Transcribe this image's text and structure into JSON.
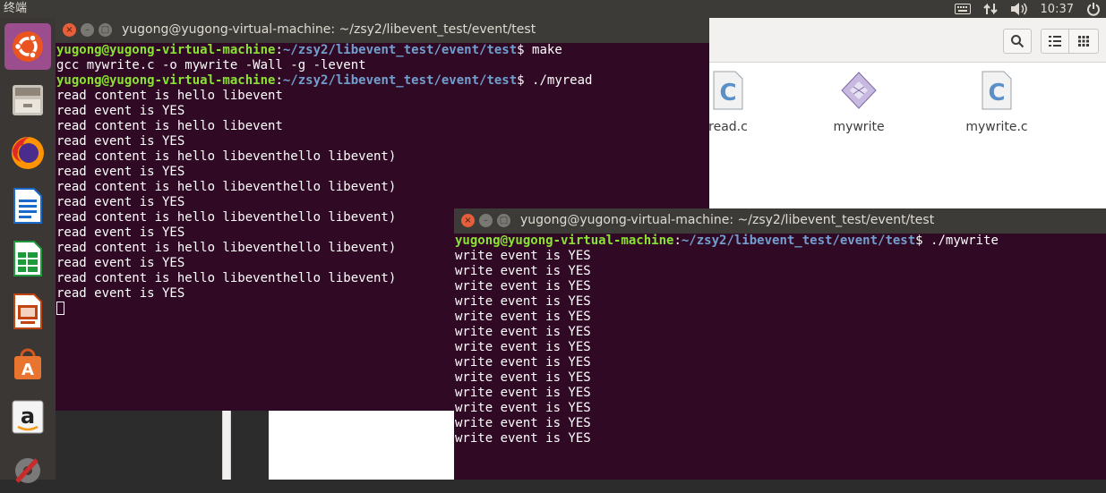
{
  "topbar": {
    "app_title": "终端",
    "time": "10:37"
  },
  "tray_icons": [
    "keyboard-icon",
    "network-icon",
    "volume-icon",
    "power-icon"
  ],
  "launcher": {
    "items": [
      "ubuntu-dash-icon",
      "files-icon",
      "firefox-icon",
      "writer-icon",
      "calc-icon",
      "impress-icon",
      "software-center-icon",
      "amazon-icon",
      "system-settings-icon"
    ]
  },
  "file_manager": {
    "files": [
      {
        "name": "read.c",
        "icon": "c-source-file-icon"
      },
      {
        "name": "mywrite",
        "icon": "executable-file-icon"
      },
      {
        "name": "mywrite.c",
        "icon": "c-source-file-icon"
      }
    ]
  },
  "terminal_read": {
    "title": "yugong@yugong-virtual-machine: ~/zsy2/libevent_test/event/test",
    "lines": [
      {
        "user": "yugong@yugong-virtual-machine",
        "path": "~/zsy2/libevent_test/event/test",
        "cmd": "$ make"
      },
      {
        "text": "gcc mywrite.c -o mywrite -Wall -g -levent"
      },
      {
        "user": "yugong@yugong-virtual-machine",
        "path": "~/zsy2/libevent_test/event/test",
        "cmd": "$ ./myread"
      },
      {
        "text": "read content is hello libevent"
      },
      {
        "text": "read event is YES"
      },
      {
        "text": "read content is hello libevent"
      },
      {
        "text": "read event is YES"
      },
      {
        "text": "read content is hello libeventhello libevent)"
      },
      {
        "text": "read event is YES"
      },
      {
        "text": "read content is hello libeventhello libevent)"
      },
      {
        "text": "read event is YES"
      },
      {
        "text": "read content is hello libeventhello libevent)"
      },
      {
        "text": "read event is YES"
      },
      {
        "text": "read content is hello libeventhello libevent)"
      },
      {
        "text": "read event is YES"
      },
      {
        "text": "read content is hello libeventhello libevent)"
      },
      {
        "text": "read event is YES"
      }
    ]
  },
  "terminal_write": {
    "title": "yugong@yugong-virtual-machine: ~/zsy2/libevent_test/event/test",
    "lines": [
      {
        "user": "yugong@yugong-virtual-machine",
        "path": "~/zsy2/libevent_test/event/test",
        "cmd": "$ ./mywrite"
      },
      {
        "text": "write event is YES"
      },
      {
        "text": "write event is YES"
      },
      {
        "text": "write event is YES"
      },
      {
        "text": "write event is YES"
      },
      {
        "text": "write event is YES"
      },
      {
        "text": "write event is YES"
      },
      {
        "text": "write event is YES"
      },
      {
        "text": "write event is YES"
      },
      {
        "text": "write event is YES"
      },
      {
        "text": "write event is YES"
      },
      {
        "text": "write event is YES"
      },
      {
        "text": "write event is YES"
      },
      {
        "text": "write event is YES"
      }
    ]
  },
  "colors": {
    "terminal_bg": "#300a24",
    "prompt_user": "#8ae234",
    "prompt_path": "#729fcf",
    "panel_bg": "#3c3b37"
  }
}
